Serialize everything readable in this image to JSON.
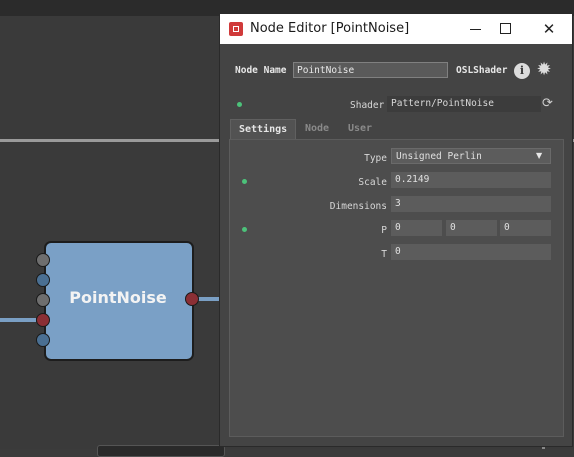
{
  "graph": {
    "node_label": "PointNoise",
    "colors": {
      "node": "#7aa0c6",
      "port_gray": "#6e6e6e",
      "port_blue": "#4a6f92",
      "port_red": "#8b2f35"
    }
  },
  "window": {
    "title": "Node Editor [PointNoise]",
    "controls": {
      "minimize": "—",
      "maximize": "☐",
      "close": "✕"
    },
    "node_name_label": "Node Name",
    "node_name_value": "PointNoise",
    "shader_type_label": "OSLShader",
    "info_icon": "info-icon",
    "gear_icon": "gear-icon",
    "shader": {
      "label": "Shader",
      "value": "Pattern/PointNoise"
    },
    "tabs": [
      "Settings",
      "Node",
      "User"
    ],
    "active_tab": "Settings",
    "params": {
      "type": {
        "label": "Type",
        "value": "Unsigned Perlin"
      },
      "scale": {
        "label": "Scale",
        "value": "0.2149"
      },
      "dimensions": {
        "label": "Dimensions",
        "value": "3"
      },
      "p": {
        "label": "P",
        "values": [
          "0",
          "0",
          "0"
        ]
      },
      "t": {
        "label": "T",
        "value": "0"
      }
    },
    "accent_colors": {
      "connected_dot": "#4cc27a",
      "app_icon": "#d03a3a"
    }
  }
}
